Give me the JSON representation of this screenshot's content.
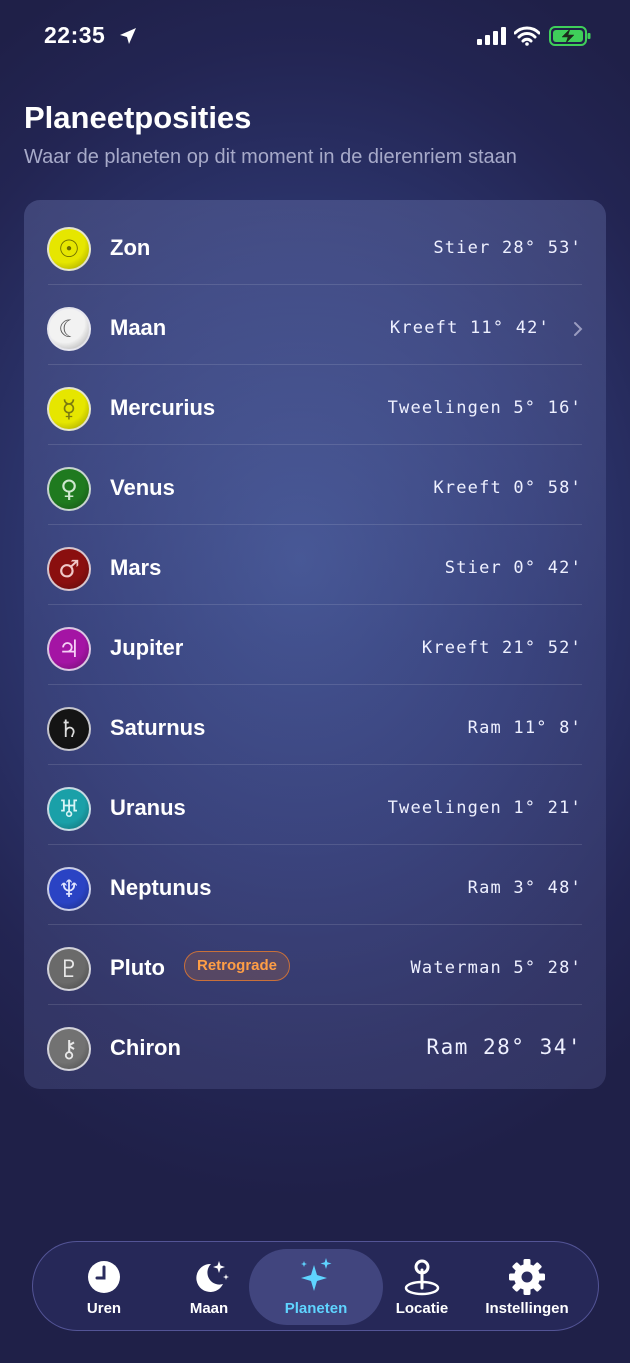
{
  "status_bar": {
    "time": "22:35"
  },
  "header": {
    "title": "Planeetposities",
    "subtitle": "Waar de planeten op dit moment in de dierenriem staan"
  },
  "planets": [
    {
      "name": "Zon",
      "position": "Stier 28° 53'",
      "symbol": "☉",
      "color": "#e6e600",
      "symbol_color": "#6b6b00"
    },
    {
      "name": "Maan",
      "position": "Kreeft 11° 42'",
      "symbol": "☾",
      "color": "#f2f2f2",
      "symbol_color": "#555555"
    },
    {
      "name": "Mercurius",
      "position": "Tweelingen 5° 16'",
      "symbol": "☿",
      "color": "#e6e600",
      "symbol_color": "#7a7a10"
    },
    {
      "name": "Venus",
      "position": "Kreeft 0° 58'",
      "symbol": "♀",
      "color": "#1f7a1f",
      "symbol_color": "#cfe8cf"
    },
    {
      "name": "Mars",
      "position": "Stier 0° 42'",
      "symbol": "♂",
      "color": "#8a0f0f",
      "symbol_color": "#f0c8c8"
    },
    {
      "name": "Jupiter",
      "position": "Kreeft 21° 52'",
      "symbol": "♃",
      "color": "#a414a4",
      "symbol_color": "#f6d0f6"
    },
    {
      "name": "Saturnus",
      "position": "Ram 11° 8'",
      "symbol": "♄",
      "color": "#141414",
      "symbol_color": "#dddddd"
    },
    {
      "name": "Uranus",
      "position": "Tweelingen 1° 21'",
      "symbol": "♅",
      "color": "#1aa0a8",
      "symbol_color": "#d8f4f6"
    },
    {
      "name": "Neptunus",
      "position": "Ram 3° 48'",
      "symbol": "♆",
      "color": "#2a43c4",
      "symbol_color": "#dfe4ff"
    },
    {
      "name": "Pluto",
      "position": "Waterman 5° 28'",
      "symbol": "♇",
      "color": "#6a6a6a",
      "symbol_color": "#e8e8e8",
      "badge": "Retrograde"
    },
    {
      "name": "Chiron",
      "position": "Ram 28° 34'",
      "symbol": "⚷",
      "color": "#727272",
      "symbol_color": "#e8e8e8"
    }
  ],
  "tabs": [
    {
      "label": "Uren",
      "icon": "clock-icon",
      "active": false
    },
    {
      "label": "Maan",
      "icon": "moon-stars-icon",
      "active": false
    },
    {
      "label": "Planeten",
      "icon": "sparkles-icon",
      "active": true
    },
    {
      "label": "Locatie",
      "icon": "location-pin-icon",
      "active": false
    },
    {
      "label": "Instellingen",
      "icon": "gear-icon",
      "active": false
    }
  ],
  "colors": {
    "accent": "#5fd4ff",
    "badge": "#ff9e45"
  }
}
